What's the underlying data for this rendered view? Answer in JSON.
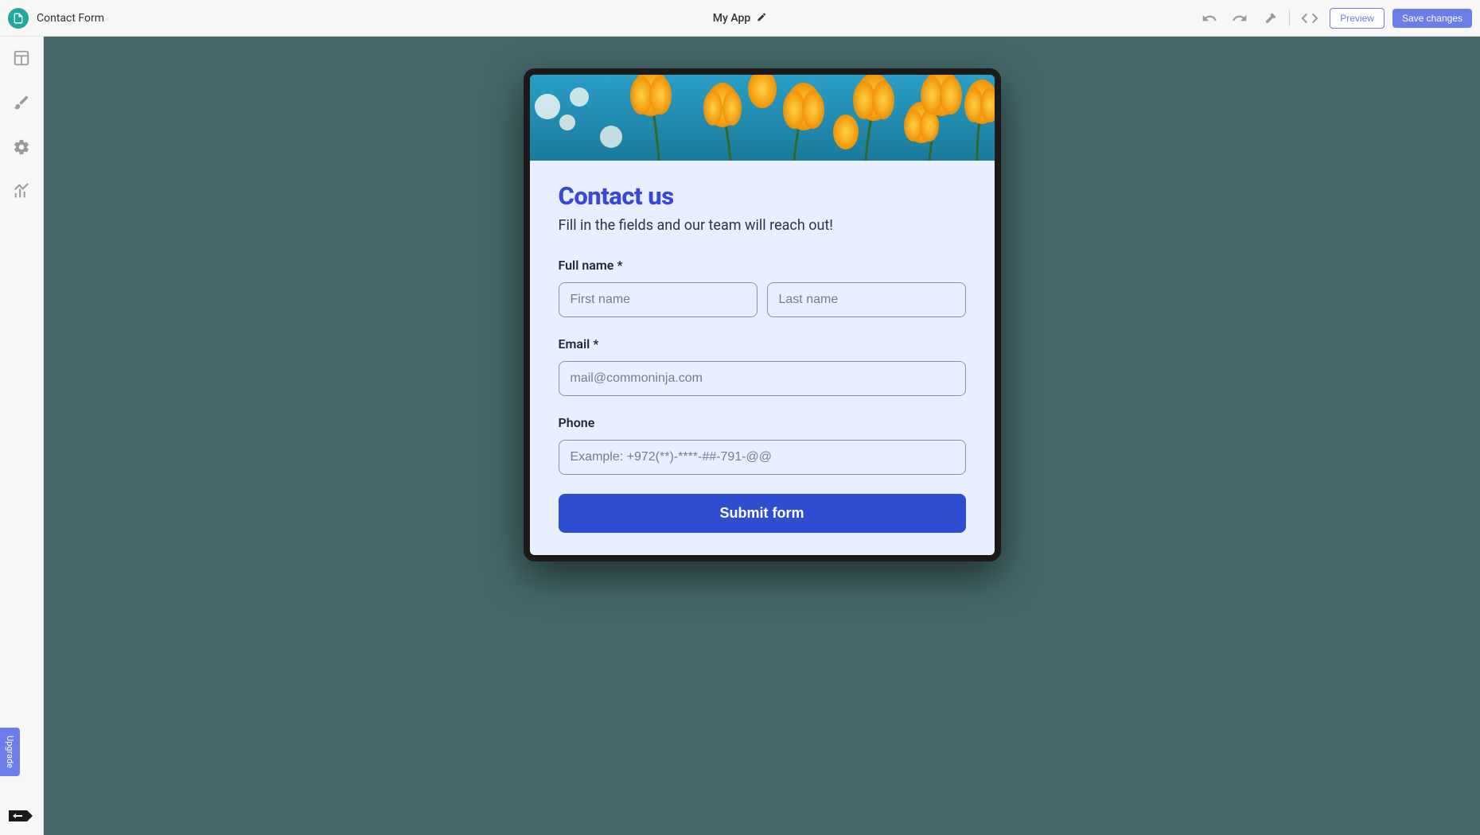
{
  "topbar": {
    "page_name": "Contact Form",
    "app_title": "My App",
    "preview_label": "Preview",
    "save_label": "Save changes"
  },
  "sidebar": {
    "icons": {
      "layout": "layout-icon",
      "brush": "brush-icon",
      "gear": "gear-icon",
      "chart": "chart-icon"
    },
    "upgrade_label": "Upgrade"
  },
  "form": {
    "title": "Contact us",
    "subtitle": "Fill in the fields and our team will reach out!",
    "fullname_label": "Full name *",
    "first_name_placeholder": "First name",
    "last_name_placeholder": "Last name",
    "email_label": "Email *",
    "email_placeholder": "mail@commoninja.com",
    "phone_label": "Phone",
    "phone_placeholder": "Example: +972(**)-****-##-791-@@",
    "submit_label": "Submit form"
  },
  "colors": {
    "accent": "#6a7de8",
    "form_title": "#3948d9",
    "submit": "#2e4dd0",
    "canvas_bg": "#46686b"
  }
}
